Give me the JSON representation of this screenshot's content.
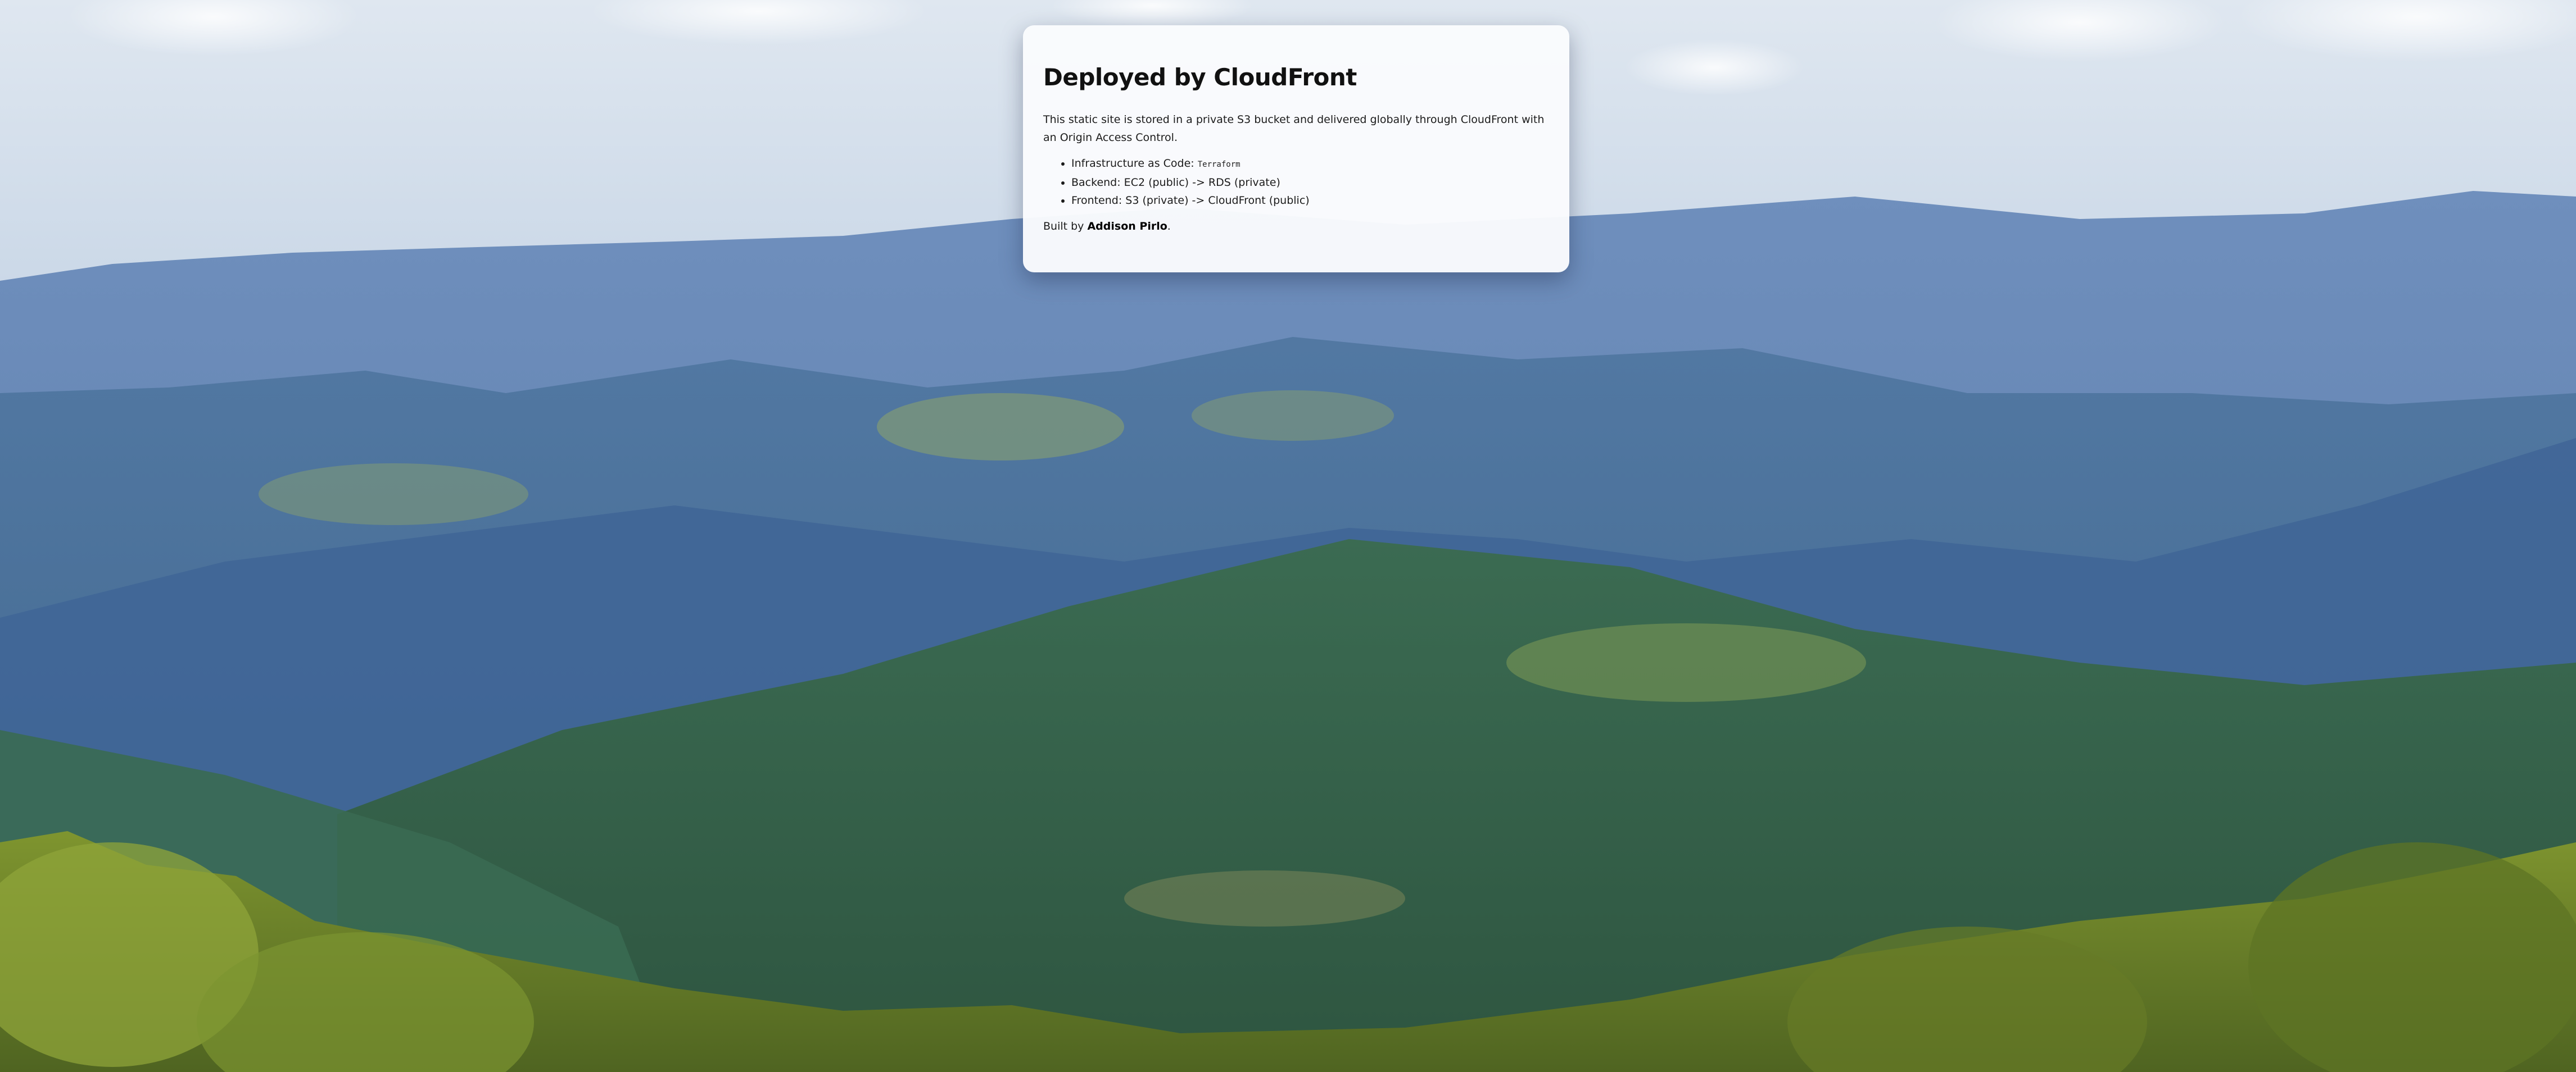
{
  "background": {
    "icon": "mountain-landscape-photo",
    "sky_color": "#c9d7e6",
    "ridge_color": "#5d7ca6",
    "forest_color": "#3e6b3e",
    "foreground_color": "#6e8a2b"
  },
  "card": {
    "title": "Deployed by CloudFront",
    "intro": "This static site is stored in a private S3 bucket and delivered globally through CloudFront with an Origin Access Control.",
    "items": [
      {
        "prefix": "Infrastructure as Code: ",
        "code": "Terraform",
        "text": "Infrastructure as Code: "
      },
      {
        "text": "Backend: EC2 (public) -> RDS (private)"
      },
      {
        "text": "Frontend: S3 (private) -> CloudFront (public)"
      }
    ],
    "built_prefix": "Built by ",
    "author": "Addison Pirlo",
    "built_suffix": "."
  }
}
